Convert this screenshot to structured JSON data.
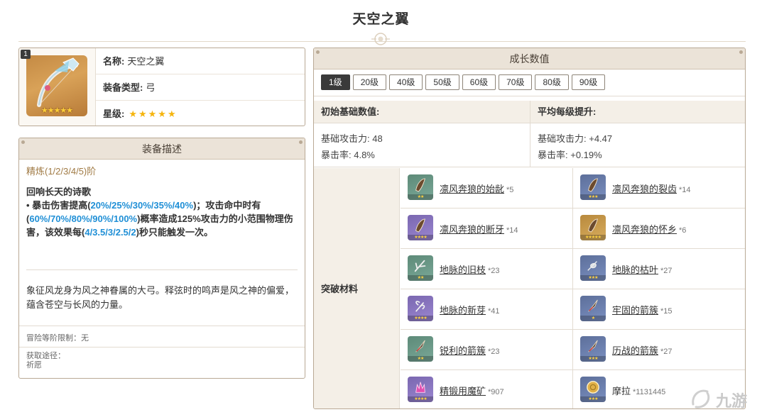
{
  "page_title": "天空之翼",
  "info": {
    "level_badge": "1",
    "rows": [
      {
        "key": "名称:",
        "value": "天空之翼"
      },
      {
        "key": "装备类型:",
        "value": "弓"
      },
      {
        "key": "星级:",
        "value": "★★★★★"
      }
    ],
    "image_stars": "★★★★★"
  },
  "description": {
    "header": "装备描述",
    "refine": "精炼(1/2/3/4/5)阶",
    "skill_name": "回响长天的诗歌",
    "skill_bullet": "•",
    "skill_part1": "暴击伤害提高(",
    "skill_hl1": "20%/25%/30%/35%/40%",
    "skill_part2": ")；攻击命中时有(",
    "skill_hl2": "60%/70%/80%/90%/100%",
    "skill_part3": ")概率造成125%攻击力的小范围物理伤害，该效果每(",
    "skill_hl3": "4/3.5/3/2.5/2",
    "skill_part4": ")秒只能触发一次。",
    "lore": "象征风龙身为风之神眷属的大弓。释弦时的鸣声是风之神的偏爱，蕴含苍空与长风的力量。",
    "adventure_limit": "冒险等阶限制：无",
    "obtain_label": "获取途径：",
    "obtain_value": "祈愿"
  },
  "growth": {
    "header": "成长数值",
    "levels": [
      "1级",
      "20级",
      "40级",
      "50级",
      "60级",
      "70级",
      "80级",
      "90级"
    ],
    "active_level": 0,
    "base_label": "初始基础数值:",
    "per_level_label": "平均每级提升:",
    "base_stats": [
      "基础攻击力: 48",
      "暴击率: 4.8%"
    ],
    "per_level_stats": [
      "基础攻击力: +4.47",
      "暴击率: +0.19%"
    ],
    "materials_label": "突破材料",
    "materials": [
      {
        "name": "凛风奔狼的始龀",
        "count": "*5",
        "stars": "★★",
        "color": "green",
        "icon": "tooth-icon"
      },
      {
        "name": "凛风奔狼的裂齿",
        "count": "*14",
        "stars": "★★★",
        "color": "blue",
        "icon": "tooth-icon"
      },
      {
        "name": "凛风奔狼的断牙",
        "count": "*14",
        "stars": "★★★★",
        "color": "purple",
        "icon": "tooth-icon"
      },
      {
        "name": "凛风奔狼的怀乡",
        "count": "*6",
        "stars": "★★★★★",
        "color": "gold",
        "icon": "tooth-icon"
      },
      {
        "name": "地脉的旧枝",
        "count": "*23",
        "stars": "★★",
        "color": "green",
        "icon": "branch-icon"
      },
      {
        "name": "地脉的枯叶",
        "count": "*27",
        "stars": "★★★",
        "color": "blue",
        "icon": "leaf-icon"
      },
      {
        "name": "地脉的新芽",
        "count": "*41",
        "stars": "★★★★",
        "color": "purple",
        "icon": "sprout-icon"
      },
      {
        "name": "牢固的箭簇",
        "count": "*15",
        "stars": "★",
        "color": "gray",
        "icon": "arrowhead-icon"
      },
      {
        "name": "锐利的箭簇",
        "count": "*23",
        "stars": "★★",
        "color": "green",
        "icon": "arrowhead-icon"
      },
      {
        "name": "历战的箭簇",
        "count": "*27",
        "stars": "★★★",
        "color": "blue",
        "icon": "arrowhead-icon"
      },
      {
        "name": "精锻用魔矿",
        "count": "*907",
        "stars": "★★★★",
        "color": "purple",
        "icon": "crystal-icon"
      },
      {
        "name": "摩拉",
        "count": "*1131445",
        "stars": "★★★",
        "color": "blue",
        "icon": "coin-icon"
      }
    ]
  },
  "watermark": "九游"
}
